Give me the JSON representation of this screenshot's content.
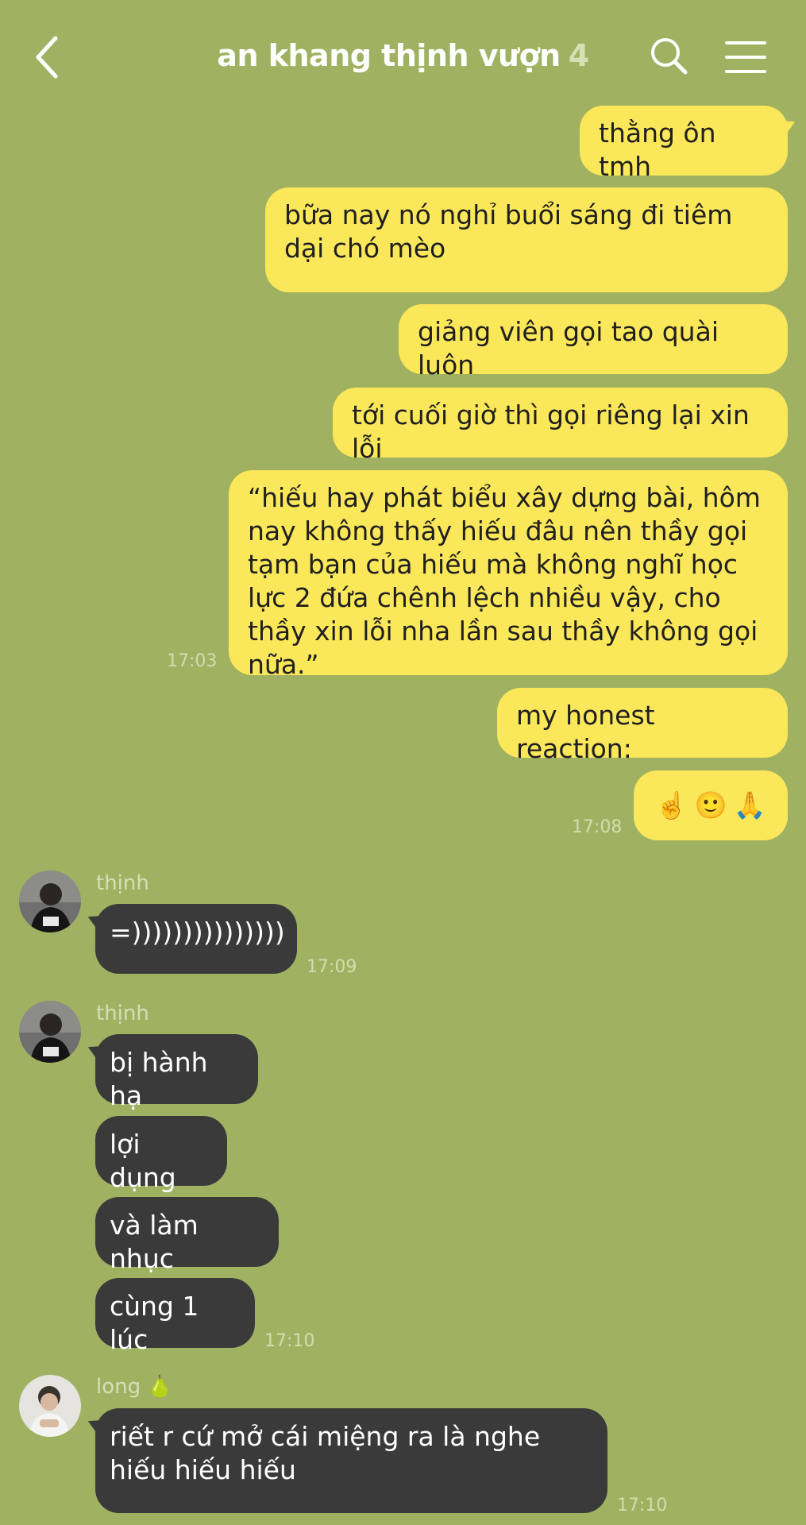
{
  "header": {
    "title": "an khang thịnh vượn",
    "member_count": "4"
  },
  "messages_out": [
    {
      "text": "thằng ôn tmh"
    },
    {
      "text": "bữa nay nó nghỉ buổi sáng đi tiêm dại chó mèo"
    },
    {
      "text": "giảng viên gọi tao quài luôn"
    },
    {
      "text": "tới cuối giờ thì gọi riêng lại xin lỗi"
    },
    {
      "text": "“hiếu hay phát biểu xây dựng bài, hôm nay không thấy hiếu đâu nên thầy gọi tạm bạn của hiếu mà không nghĩ học lực 2 đứa chênh lệch nhiều vậy, cho thầy xin lỗi nha lần sau thầy không gọi nữa.”",
      "time": "17:03"
    },
    {
      "text": "my honest reaction:"
    },
    {
      "emoji": [
        "☝️",
        "🙂",
        "🙏"
      ],
      "emoji_names": [
        "pointing-up-emoji",
        "slight-smile-emoji",
        "hand-emoji"
      ],
      "time": "17:08"
    }
  ],
  "groups_in": [
    {
      "sender": "thịnh",
      "messages": [
        "=)))))))))))))))"
      ],
      "time": "17:09"
    },
    {
      "sender": "thịnh",
      "messages": [
        "bị hành hạ",
        "lợi dụng",
        "và làm nhục",
        "cùng 1 lúc"
      ],
      "time": "17:10"
    },
    {
      "sender": "long",
      "sender_emoji": "🍐",
      "messages": [
        "riết r cứ mở cái miệng ra là nghe hiếu hiếu hiếu"
      ],
      "time": "17:10"
    }
  ],
  "colors": {
    "background": "#a0b262",
    "outgoing_bubble": "#fbe75a",
    "incoming_bubble": "#3a3a3a"
  }
}
